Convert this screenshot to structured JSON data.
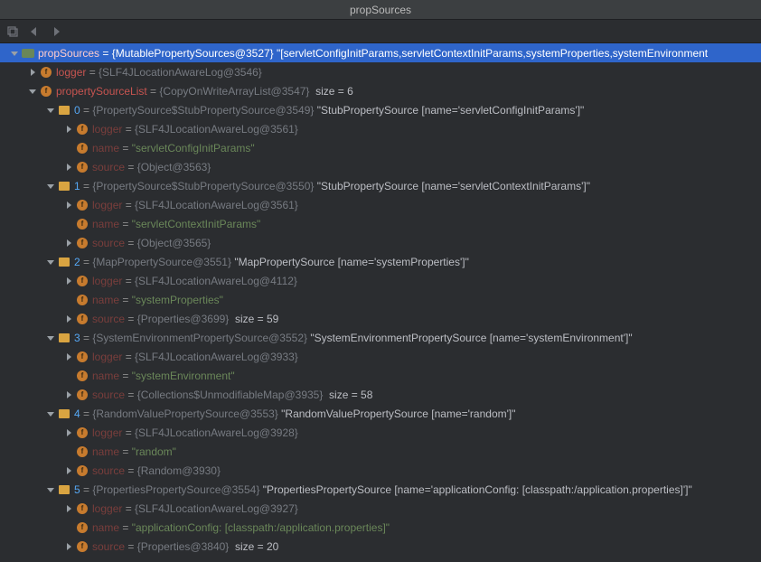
{
  "title": "propSources",
  "rows": [
    {
      "indent": 0,
      "arrow": "down",
      "icon": "green",
      "sel": true,
      "spans": [
        {
          "t": "propSources",
          "cls": "nm-red"
        },
        {
          "t": " = ",
          "cls": "pale"
        },
        {
          "t": "{MutablePropertySources@3527}",
          "cls": "ref"
        },
        {
          "t": " ",
          "cls": "pale"
        },
        {
          "t": "\"[servletConfigInitParams,servletContextInitParams,systemProperties,systemEnvironment",
          "cls": "num"
        }
      ]
    },
    {
      "indent": 1,
      "arrow": "right",
      "icon": "field",
      "spans": [
        {
          "t": "logger",
          "cls": "nm-red"
        },
        {
          "t": " = ",
          "cls": "pale"
        },
        {
          "t": "{SLF4JLocationAwareLog@3546}",
          "cls": "ref"
        }
      ]
    },
    {
      "indent": 1,
      "arrow": "down",
      "icon": "field",
      "spans": [
        {
          "t": "propertySourceList",
          "cls": "nm-red"
        },
        {
          "t": " = ",
          "cls": "pale"
        },
        {
          "t": "{CopyOnWriteArrayList@3547}",
          "cls": "ref"
        },
        {
          "t": "  size = 6",
          "cls": "num"
        }
      ]
    },
    {
      "indent": 2,
      "arrow": "down",
      "icon": "list",
      "spans": [
        {
          "t": "0",
          "cls": "nm-blue"
        },
        {
          "t": " = ",
          "cls": "pale"
        },
        {
          "t": "{PropertySource$StubPropertySource@3549}",
          "cls": "ref"
        },
        {
          "t": " ",
          "cls": "pale"
        },
        {
          "t": "\"StubPropertySource [name='servletConfigInitParams']\"",
          "cls": "num"
        }
      ]
    },
    {
      "indent": 3,
      "arrow": "right",
      "icon": "field",
      "spans": [
        {
          "t": "logger",
          "cls": "nm-reddk"
        },
        {
          "t": " = ",
          "cls": "pale"
        },
        {
          "t": "{SLF4JLocationAwareLog@3561}",
          "cls": "ref"
        }
      ]
    },
    {
      "indent": 3,
      "arrow": "none",
      "icon": "field",
      "spans": [
        {
          "t": "name",
          "cls": "nm-reddk"
        },
        {
          "t": " = ",
          "cls": "pale"
        },
        {
          "t": "\"servletConfigInitParams\"",
          "cls": "str"
        }
      ]
    },
    {
      "indent": 3,
      "arrow": "right",
      "icon": "field",
      "spans": [
        {
          "t": "source",
          "cls": "nm-reddk"
        },
        {
          "t": " = ",
          "cls": "pale"
        },
        {
          "t": "{Object@3563}",
          "cls": "ref"
        }
      ]
    },
    {
      "indent": 2,
      "arrow": "down",
      "icon": "list",
      "spans": [
        {
          "t": "1",
          "cls": "nm-blue"
        },
        {
          "t": " = ",
          "cls": "pale"
        },
        {
          "t": "{PropertySource$StubPropertySource@3550}",
          "cls": "ref"
        },
        {
          "t": " ",
          "cls": "pale"
        },
        {
          "t": "\"StubPropertySource [name='servletContextInitParams']\"",
          "cls": "num"
        }
      ]
    },
    {
      "indent": 3,
      "arrow": "right",
      "icon": "field",
      "spans": [
        {
          "t": "logger",
          "cls": "nm-reddk"
        },
        {
          "t": " = ",
          "cls": "pale"
        },
        {
          "t": "{SLF4JLocationAwareLog@3561}",
          "cls": "ref"
        }
      ]
    },
    {
      "indent": 3,
      "arrow": "none",
      "icon": "field",
      "spans": [
        {
          "t": "name",
          "cls": "nm-reddk"
        },
        {
          "t": " = ",
          "cls": "pale"
        },
        {
          "t": "\"servletContextInitParams\"",
          "cls": "str"
        }
      ]
    },
    {
      "indent": 3,
      "arrow": "right",
      "icon": "field",
      "spans": [
        {
          "t": "source",
          "cls": "nm-reddk"
        },
        {
          "t": " = ",
          "cls": "pale"
        },
        {
          "t": "{Object@3565}",
          "cls": "ref"
        }
      ]
    },
    {
      "indent": 2,
      "arrow": "down",
      "icon": "list",
      "spans": [
        {
          "t": "2",
          "cls": "nm-blue"
        },
        {
          "t": " = ",
          "cls": "pale"
        },
        {
          "t": "{MapPropertySource@3551}",
          "cls": "ref"
        },
        {
          "t": " ",
          "cls": "pale"
        },
        {
          "t": "\"MapPropertySource [name='systemProperties']\"",
          "cls": "num"
        }
      ]
    },
    {
      "indent": 3,
      "arrow": "right",
      "icon": "field",
      "spans": [
        {
          "t": "logger",
          "cls": "nm-reddk"
        },
        {
          "t": " = ",
          "cls": "pale"
        },
        {
          "t": "{SLF4JLocationAwareLog@4112}",
          "cls": "ref"
        }
      ]
    },
    {
      "indent": 3,
      "arrow": "none",
      "icon": "field",
      "spans": [
        {
          "t": "name",
          "cls": "nm-reddk"
        },
        {
          "t": " = ",
          "cls": "pale"
        },
        {
          "t": "\"systemProperties\"",
          "cls": "str"
        }
      ]
    },
    {
      "indent": 3,
      "arrow": "right",
      "icon": "field",
      "spans": [
        {
          "t": "source",
          "cls": "nm-reddk"
        },
        {
          "t": " = ",
          "cls": "pale"
        },
        {
          "t": "{Properties@3699}",
          "cls": "ref"
        },
        {
          "t": "  size = 59",
          "cls": "num"
        }
      ]
    },
    {
      "indent": 2,
      "arrow": "down",
      "icon": "list",
      "spans": [
        {
          "t": "3",
          "cls": "nm-blue"
        },
        {
          "t": " = ",
          "cls": "pale"
        },
        {
          "t": "{SystemEnvironmentPropertySource@3552}",
          "cls": "ref"
        },
        {
          "t": " ",
          "cls": "pale"
        },
        {
          "t": "\"SystemEnvironmentPropertySource [name='systemEnvironment']\"",
          "cls": "num"
        }
      ]
    },
    {
      "indent": 3,
      "arrow": "right",
      "icon": "field",
      "spans": [
        {
          "t": "logger",
          "cls": "nm-reddk"
        },
        {
          "t": " = ",
          "cls": "pale"
        },
        {
          "t": "{SLF4JLocationAwareLog@3933}",
          "cls": "ref"
        }
      ]
    },
    {
      "indent": 3,
      "arrow": "none",
      "icon": "field",
      "spans": [
        {
          "t": "name",
          "cls": "nm-reddk"
        },
        {
          "t": " = ",
          "cls": "pale"
        },
        {
          "t": "\"systemEnvironment\"",
          "cls": "str"
        }
      ]
    },
    {
      "indent": 3,
      "arrow": "right",
      "icon": "field",
      "spans": [
        {
          "t": "source",
          "cls": "nm-reddk"
        },
        {
          "t": " = ",
          "cls": "pale"
        },
        {
          "t": "{Collections$UnmodifiableMap@3935}",
          "cls": "ref"
        },
        {
          "t": "  size = 58",
          "cls": "num"
        }
      ]
    },
    {
      "indent": 2,
      "arrow": "down",
      "icon": "list",
      "spans": [
        {
          "t": "4",
          "cls": "nm-blue"
        },
        {
          "t": " = ",
          "cls": "pale"
        },
        {
          "t": "{RandomValuePropertySource@3553}",
          "cls": "ref"
        },
        {
          "t": " ",
          "cls": "pale"
        },
        {
          "t": "\"RandomValuePropertySource [name='random']\"",
          "cls": "num"
        }
      ]
    },
    {
      "indent": 3,
      "arrow": "right",
      "icon": "field",
      "spans": [
        {
          "t": "logger",
          "cls": "nm-reddk"
        },
        {
          "t": " = ",
          "cls": "pale"
        },
        {
          "t": "{SLF4JLocationAwareLog@3928}",
          "cls": "ref"
        }
      ]
    },
    {
      "indent": 3,
      "arrow": "none",
      "icon": "field",
      "spans": [
        {
          "t": "name",
          "cls": "nm-reddk"
        },
        {
          "t": " = ",
          "cls": "pale"
        },
        {
          "t": "\"random\"",
          "cls": "str"
        }
      ]
    },
    {
      "indent": 3,
      "arrow": "right",
      "icon": "field",
      "spans": [
        {
          "t": "source",
          "cls": "nm-reddk"
        },
        {
          "t": " = ",
          "cls": "pale"
        },
        {
          "t": "{Random@3930}",
          "cls": "ref"
        }
      ]
    },
    {
      "indent": 2,
      "arrow": "down",
      "icon": "list",
      "spans": [
        {
          "t": "5",
          "cls": "nm-blue"
        },
        {
          "t": " = ",
          "cls": "pale"
        },
        {
          "t": "{PropertiesPropertySource@3554}",
          "cls": "ref"
        },
        {
          "t": " ",
          "cls": "pale"
        },
        {
          "t": "\"PropertiesPropertySource [name='applicationConfig: [classpath:/application.properties]']\"",
          "cls": "num"
        }
      ]
    },
    {
      "indent": 3,
      "arrow": "right",
      "icon": "field",
      "spans": [
        {
          "t": "logger",
          "cls": "nm-reddk"
        },
        {
          "t": " = ",
          "cls": "pale"
        },
        {
          "t": "{SLF4JLocationAwareLog@3927}",
          "cls": "ref"
        }
      ]
    },
    {
      "indent": 3,
      "arrow": "none",
      "icon": "field",
      "spans": [
        {
          "t": "name",
          "cls": "nm-reddk"
        },
        {
          "t": " = ",
          "cls": "pale"
        },
        {
          "t": "\"applicationConfig: [classpath:/application.properties]\"",
          "cls": "str"
        }
      ]
    },
    {
      "indent": 3,
      "arrow": "right",
      "icon": "field",
      "spans": [
        {
          "t": "source",
          "cls": "nm-reddk"
        },
        {
          "t": " = ",
          "cls": "pale"
        },
        {
          "t": "{Properties@3840}",
          "cls": "ref"
        },
        {
          "t": "  size = 20",
          "cls": "num"
        }
      ]
    }
  ]
}
